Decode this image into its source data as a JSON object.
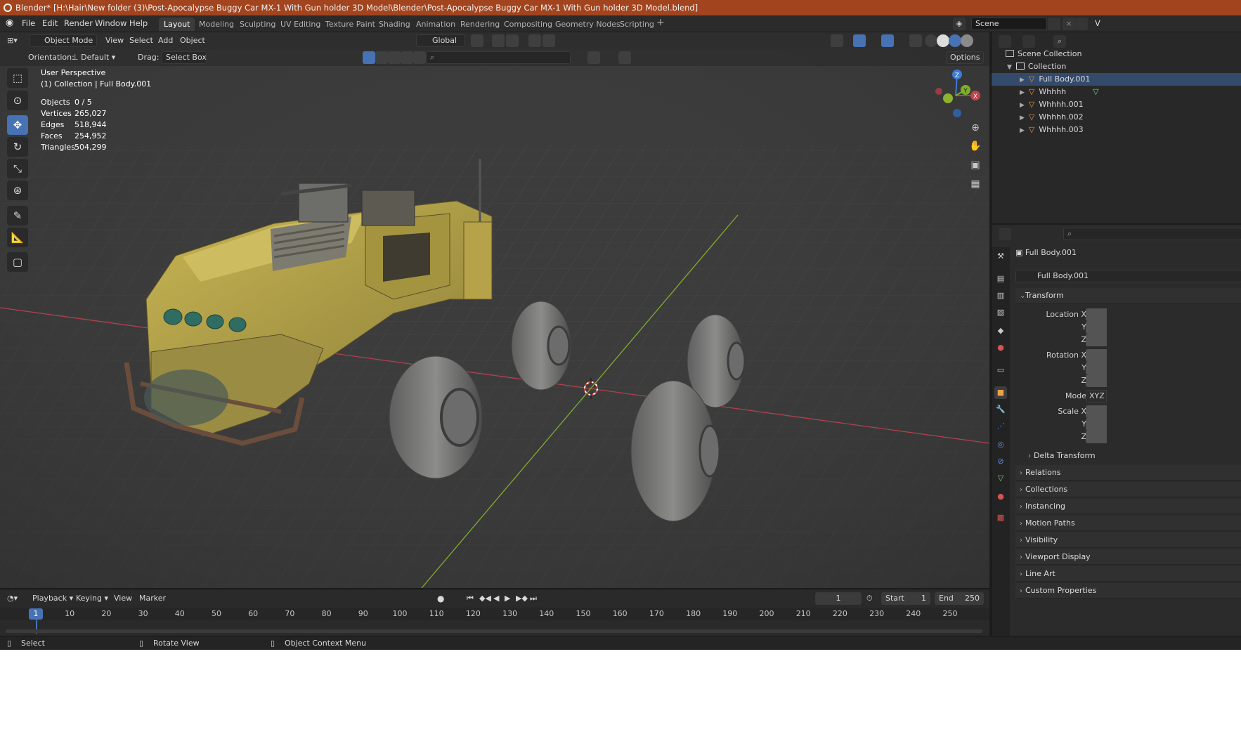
{
  "window": {
    "title": "Blender* [H:\\Hair\\New folder (3)\\Post-Apocalypse Buggy Car MX-1 With Gun holder 3D Model\\Blender\\Post-Apocalypse Buggy Car MX-1 With Gun holder 3D Model.blend]"
  },
  "menu": [
    "File",
    "Edit",
    "Render",
    "Window",
    "Help"
  ],
  "workspaces": [
    "Layout",
    "Modeling",
    "Sculpting",
    "UV Editing",
    "Texture Paint",
    "Shading",
    "Animation",
    "Rendering",
    "Compositing",
    "Geometry Nodes",
    "Scripting"
  ],
  "workspace_active": "Layout",
  "add_tab": "+",
  "scene": {
    "name": "Scene",
    "viewlayer_initial": "V"
  },
  "viewport_header": {
    "mode": "Object Mode",
    "menus": [
      "View",
      "Select",
      "Add",
      "Object"
    ],
    "transform_orientation": "Global"
  },
  "tool_settings": {
    "orientation_label": "Orientation:",
    "orientation_value": "Default",
    "drag_label": "Drag:",
    "drag_value": "Select Box",
    "options": "Options"
  },
  "overlay_info": {
    "view_name": "User Perspective",
    "collection_line": "(1) Collection | Full Body.001",
    "stats": [
      {
        "label": "Objects",
        "value": "0 / 5"
      },
      {
        "label": "Vertices",
        "value": "265,027"
      },
      {
        "label": "Edges",
        "value": "518,944"
      },
      {
        "label": "Faces",
        "value": "254,952"
      },
      {
        "label": "Triangles",
        "value": "504,299"
      }
    ]
  },
  "gizmo": {
    "z": "Z",
    "y": "Y",
    "x": "X"
  },
  "outliner": {
    "scene_collection": "Scene Collection",
    "collection": "Collection",
    "objects": [
      "Full Body.001",
      "Whhhh",
      "Whhhh.001",
      "Whhhh.002",
      "Whhhh.003"
    ]
  },
  "properties": {
    "object_name": "Full Body.001",
    "data_name": "Full Body.001",
    "transform_panel": "Transform",
    "location_labels": [
      "Location X",
      "Y",
      "Z"
    ],
    "rotation_labels": [
      "Rotation X",
      "Y",
      "Z"
    ],
    "mode_label": "Mode",
    "mode_value": "XYZ",
    "scale_labels": [
      "Scale X",
      "Y",
      "Z"
    ],
    "delta_transform": "Delta Transform",
    "panels": [
      "Relations",
      "Collections",
      "Instancing",
      "Motion Paths",
      "Visibility",
      "Viewport Display",
      "Line Art",
      "Custom Properties"
    ]
  },
  "timeline": {
    "menus": [
      "Playback",
      "Keying",
      "View",
      "Marker"
    ],
    "current_frame": "1",
    "start_label": "Start",
    "start_value": "1",
    "end_label": "End",
    "end_value": "250",
    "playhead": "1",
    "ticks": [
      "10",
      "20",
      "30",
      "40",
      "50",
      "60",
      "70",
      "80",
      "90",
      "100",
      "110",
      "120",
      "130",
      "140",
      "150",
      "160",
      "170",
      "180",
      "190",
      "200",
      "210",
      "220",
      "230",
      "240",
      "250"
    ]
  },
  "statusbar": {
    "select": "Select",
    "rotate": "Rotate View",
    "context": "Object Context Menu"
  },
  "colors": {
    "title_bar": "#a2441e",
    "accent_blue": "#4772b3",
    "x_axis": "#c2414a",
    "y_axis": "#7fae2c",
    "z_axis": "#3d7bd6"
  },
  "icons": [
    "blender-logo-icon",
    "select-box-icon",
    "cursor-icon",
    "move-icon",
    "rotate-icon",
    "scale-icon",
    "transform-icon",
    "annotate-icon",
    "measure-icon",
    "add-cube-icon",
    "zoom-icon",
    "hand-icon",
    "camera-icon",
    "grid-icon",
    "mesh-triangle-icon",
    "object-square-icon"
  ]
}
